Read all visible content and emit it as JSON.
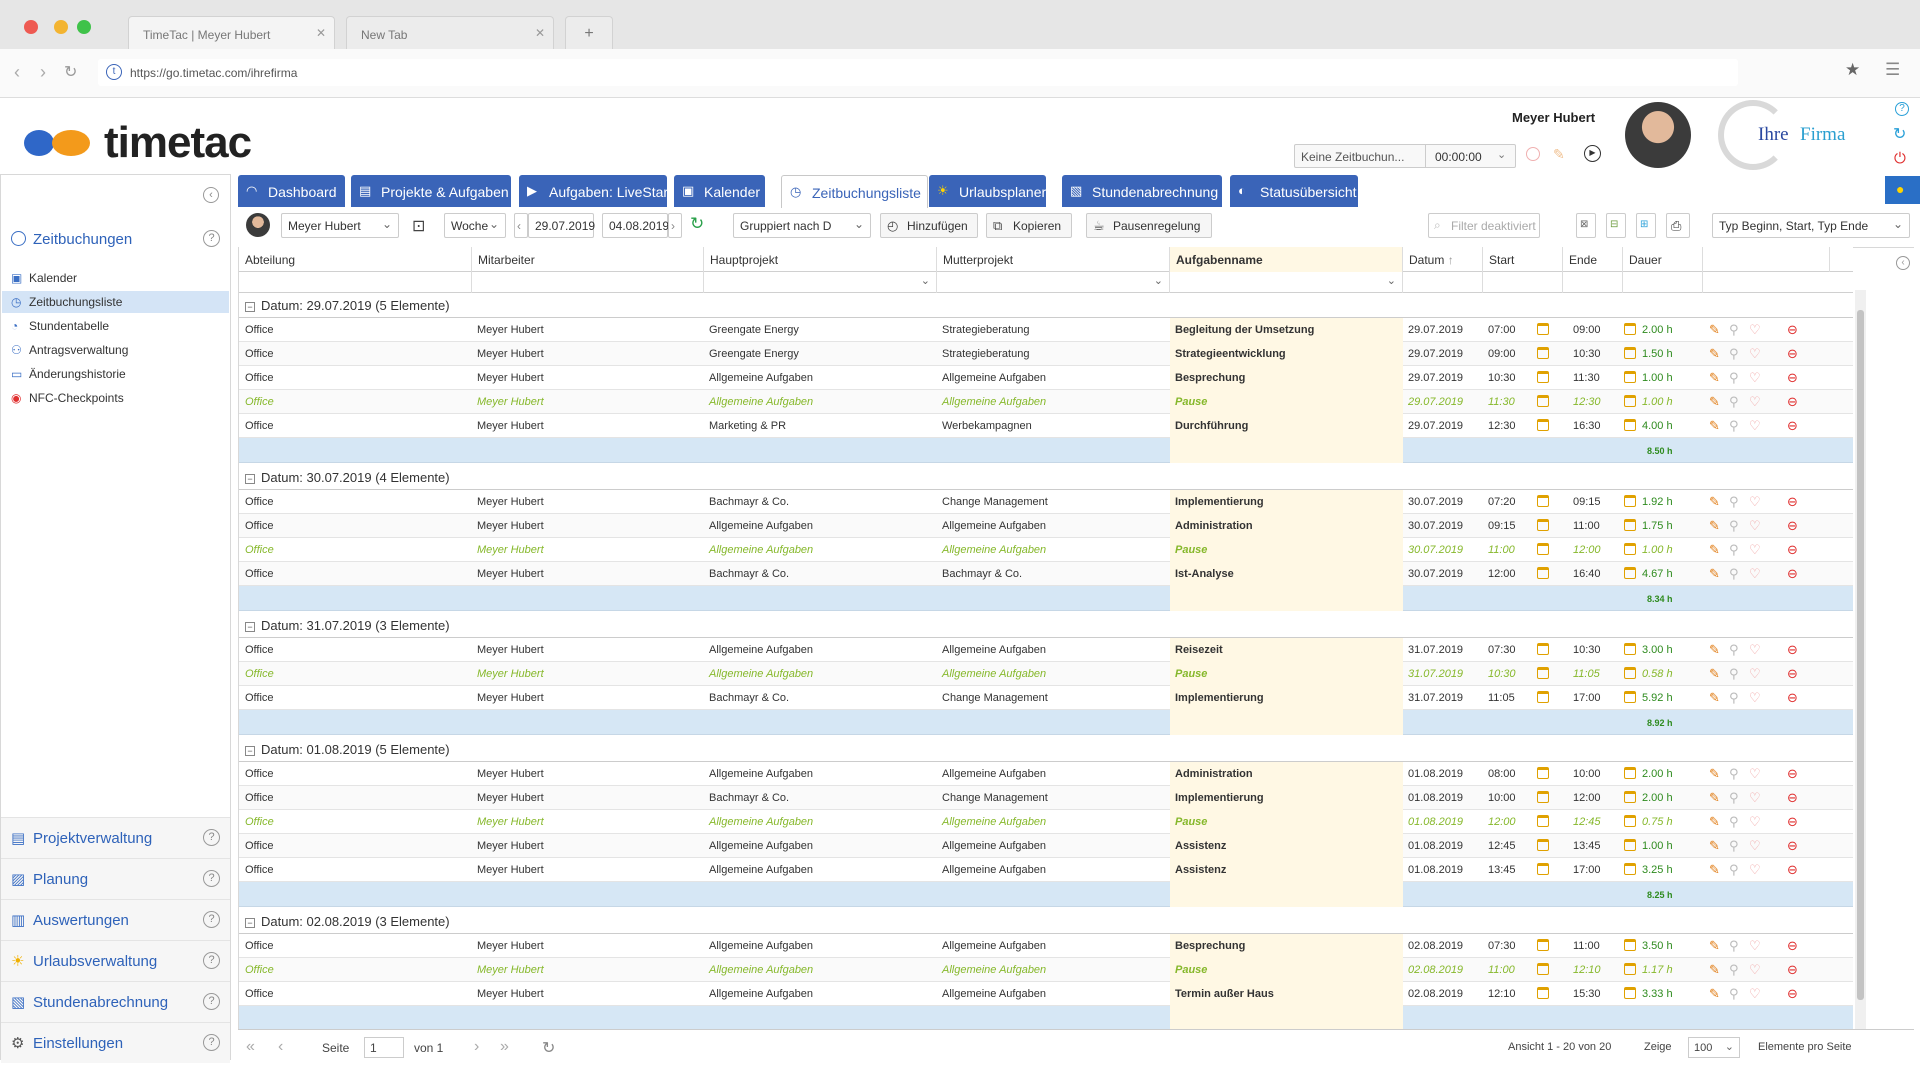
{
  "browser": {
    "tabs": [
      {
        "label": "TimeTac | Meyer Hubert"
      },
      {
        "label": "New Tab"
      }
    ],
    "new_tab_symbol": "+",
    "url": "https://go.timetac.com/ihrefirma"
  },
  "header": {
    "logo_text": "timetac",
    "user_name": "Meyer Hubert",
    "booking_status": "Keine Zeitbuchun...",
    "timer": "00:00:00",
    "company_logo_text_1": "Ihre",
    "company_logo_text_2": "Firma"
  },
  "sidebar": {
    "section_title": "Zeitbuchungen",
    "items": [
      {
        "label": "Kalender",
        "icon": "calendar-icon"
      },
      {
        "label": "Zeitbuchungsliste",
        "icon": "clock-icon"
      },
      {
        "label": "Stundentabelle",
        "icon": "timesheet-icon"
      },
      {
        "label": "Antragsverwaltung",
        "icon": "request-icon"
      },
      {
        "label": "Änderungshistorie",
        "icon": "history-icon"
      },
      {
        "label": "NFC-Checkpoints",
        "icon": "nfc-icon"
      }
    ],
    "modules": [
      {
        "label": "Projektverwaltung",
        "icon": "clipboard-icon"
      },
      {
        "label": "Planung",
        "icon": "chart-line-icon"
      },
      {
        "label": "Auswertungen",
        "icon": "bar-chart-icon"
      },
      {
        "label": "Urlaubsverwaltung",
        "icon": "sun-icon"
      },
      {
        "label": "Stundenabrechnung",
        "icon": "document-icon"
      },
      {
        "label": "Einstellungen",
        "icon": "gear-icon"
      }
    ]
  },
  "main_tabs": [
    {
      "label": "Dashboard"
    },
    {
      "label": "Projekte & Aufgaben"
    },
    {
      "label": "Aufgaben: LiveStart"
    },
    {
      "label": "Kalender"
    },
    {
      "label": "Zeitbuchungsliste"
    },
    {
      "label": "Urlaubsplaner"
    },
    {
      "label": "Stundenabrechnung"
    },
    {
      "label": "Statusübersicht"
    }
  ],
  "toolbar": {
    "employee": "Meyer Hubert",
    "period": "Woche",
    "date_from": "29.07.2019",
    "date_to": "04.08.2019",
    "group_by": "Gruppiert nach D",
    "add": "Hinzufügen",
    "copy": "Kopieren",
    "break_rule": "Pausenregelung",
    "filter_placeholder": "Filter deaktiviert",
    "type_select": "Typ Beginn, Start, Typ Ende"
  },
  "columns": {
    "department": "Abteilung",
    "employee": "Mitarbeiter",
    "main_project": "Hauptprojekt",
    "parent_project": "Mutterprojekt",
    "task": "Aufgabenname",
    "date": "Datum",
    "start": "Start",
    "end": "Ende",
    "duration": "Dauer"
  },
  "groups": [
    {
      "title": "Datum: 29.07.2019 (5 Elemente)",
      "total": "8.50 h",
      "rows": [
        {
          "dept": "Office",
          "emp": "Meyer Hubert",
          "main": "Greengate Energy",
          "parent": "Strategieberatung",
          "task": "Begleitung der Umsetzung",
          "date": "29.07.2019",
          "start": "07:00",
          "end": "09:00",
          "dur": "2.00 h",
          "pause": false
        },
        {
          "dept": "Office",
          "emp": "Meyer Hubert",
          "main": "Greengate Energy",
          "parent": "Strategieberatung",
          "task": "Strategieentwicklung",
          "date": "29.07.2019",
          "start": "09:00",
          "end": "10:30",
          "dur": "1.50 h",
          "pause": false
        },
        {
          "dept": "Office",
          "emp": "Meyer Hubert",
          "main": "Allgemeine Aufgaben",
          "parent": "Allgemeine Aufgaben",
          "task": "Besprechung",
          "date": "29.07.2019",
          "start": "10:30",
          "end": "11:30",
          "dur": "1.00 h",
          "pause": false
        },
        {
          "dept": "Office",
          "emp": "Meyer Hubert",
          "main": "Allgemeine Aufgaben",
          "parent": "Allgemeine Aufgaben",
          "task": "Pause",
          "date": "29.07.2019",
          "start": "11:30",
          "end": "12:30",
          "dur": "1.00 h",
          "pause": true
        },
        {
          "dept": "Office",
          "emp": "Meyer Hubert",
          "main": "Marketing & PR",
          "parent": "Werbekampagnen",
          "task": "Durchführung",
          "date": "29.07.2019",
          "start": "12:30",
          "end": "16:30",
          "dur": "4.00 h",
          "pause": false
        }
      ]
    },
    {
      "title": "Datum: 30.07.2019 (4 Elemente)",
      "total": "8.34 h",
      "rows": [
        {
          "dept": "Office",
          "emp": "Meyer Hubert",
          "main": "Bachmayr & Co.",
          "parent": "Change Management",
          "task": "Implementierung",
          "date": "30.07.2019",
          "start": "07:20",
          "end": "09:15",
          "dur": "1.92 h",
          "pause": false
        },
        {
          "dept": "Office",
          "emp": "Meyer Hubert",
          "main": "Allgemeine Aufgaben",
          "parent": "Allgemeine Aufgaben",
          "task": "Administration",
          "date": "30.07.2019",
          "start": "09:15",
          "end": "11:00",
          "dur": "1.75 h",
          "pause": false
        },
        {
          "dept": "Office",
          "emp": "Meyer Hubert",
          "main": "Allgemeine Aufgaben",
          "parent": "Allgemeine Aufgaben",
          "task": "Pause",
          "date": "30.07.2019",
          "start": "11:00",
          "end": "12:00",
          "dur": "1.00 h",
          "pause": true
        },
        {
          "dept": "Office",
          "emp": "Meyer Hubert",
          "main": "Bachmayr & Co.",
          "parent": "Bachmayr & Co.",
          "task": "Ist-Analyse",
          "date": "30.07.2019",
          "start": "12:00",
          "end": "16:40",
          "dur": "4.67 h",
          "pause": false
        }
      ]
    },
    {
      "title": "Datum: 31.07.2019 (3 Elemente)",
      "total": "8.92 h",
      "rows": [
        {
          "dept": "Office",
          "emp": "Meyer Hubert",
          "main": "Allgemeine Aufgaben",
          "parent": "Allgemeine Aufgaben",
          "task": "Reisezeit",
          "date": "31.07.2019",
          "start": "07:30",
          "end": "10:30",
          "dur": "3.00 h",
          "pause": false
        },
        {
          "dept": "Office",
          "emp": "Meyer Hubert",
          "main": "Allgemeine Aufgaben",
          "parent": "Allgemeine Aufgaben",
          "task": "Pause",
          "date": "31.07.2019",
          "start": "10:30",
          "end": "11:05",
          "dur": "0.58 h",
          "pause": true
        },
        {
          "dept": "Office",
          "emp": "Meyer Hubert",
          "main": "Bachmayr & Co.",
          "parent": "Change Management",
          "task": "Implementierung",
          "date": "31.07.2019",
          "start": "11:05",
          "end": "17:00",
          "dur": "5.92 h",
          "pause": false
        }
      ]
    },
    {
      "title": "Datum: 01.08.2019 (5 Elemente)",
      "total": "8.25 h",
      "rows": [
        {
          "dept": "Office",
          "emp": "Meyer Hubert",
          "main": "Allgemeine Aufgaben",
          "parent": "Allgemeine Aufgaben",
          "task": "Administration",
          "date": "01.08.2019",
          "start": "08:00",
          "end": "10:00",
          "dur": "2.00 h",
          "pause": false
        },
        {
          "dept": "Office",
          "emp": "Meyer Hubert",
          "main": "Bachmayr & Co.",
          "parent": "Change Management",
          "task": "Implementierung",
          "date": "01.08.2019",
          "start": "10:00",
          "end": "12:00",
          "dur": "2.00 h",
          "pause": false
        },
        {
          "dept": "Office",
          "emp": "Meyer Hubert",
          "main": "Allgemeine Aufgaben",
          "parent": "Allgemeine Aufgaben",
          "task": "Pause",
          "date": "01.08.2019",
          "start": "12:00",
          "end": "12:45",
          "dur": "0.75 h",
          "pause": true
        },
        {
          "dept": "Office",
          "emp": "Meyer Hubert",
          "main": "Allgemeine Aufgaben",
          "parent": "Allgemeine Aufgaben",
          "task": "Assistenz",
          "date": "01.08.2019",
          "start": "12:45",
          "end": "13:45",
          "dur": "1.00 h",
          "pause": false
        },
        {
          "dept": "Office",
          "emp": "Meyer Hubert",
          "main": "Allgemeine Aufgaben",
          "parent": "Allgemeine Aufgaben",
          "task": "Assistenz",
          "date": "01.08.2019",
          "start": "13:45",
          "end": "17:00",
          "dur": "3.25 h",
          "pause": false
        }
      ]
    },
    {
      "title": "Datum: 02.08.2019 (3 Elemente)",
      "total": "",
      "rows": [
        {
          "dept": "Office",
          "emp": "Meyer Hubert",
          "main": "Allgemeine Aufgaben",
          "parent": "Allgemeine Aufgaben",
          "task": "Besprechung",
          "date": "02.08.2019",
          "start": "07:30",
          "end": "11:00",
          "dur": "3.50 h",
          "pause": false
        },
        {
          "dept": "Office",
          "emp": "Meyer Hubert",
          "main": "Allgemeine Aufgaben",
          "parent": "Allgemeine Aufgaben",
          "task": "Pause",
          "date": "02.08.2019",
          "start": "11:00",
          "end": "12:10",
          "dur": "1.17 h",
          "pause": true
        },
        {
          "dept": "Office",
          "emp": "Meyer Hubert",
          "main": "Allgemeine Aufgaben",
          "parent": "Allgemeine Aufgaben",
          "task": "Termin außer Haus",
          "date": "02.08.2019",
          "start": "12:10",
          "end": "15:30",
          "dur": "3.33 h",
          "pause": false
        }
      ]
    }
  ],
  "pager": {
    "page_label": "Seite",
    "page_value": "1",
    "of_label": "von 1",
    "range": "Ansicht 1 - 20 von 20",
    "show_label": "Zeige",
    "per_page": "100",
    "per_page_label": "Elemente pro Seite"
  },
  "colors": {
    "primary": "#3a64b8",
    "pause": "#86b82b",
    "duration": "#2e8b1e",
    "sum_row": "#d6e7f5",
    "task_column": "#fff8e4"
  }
}
